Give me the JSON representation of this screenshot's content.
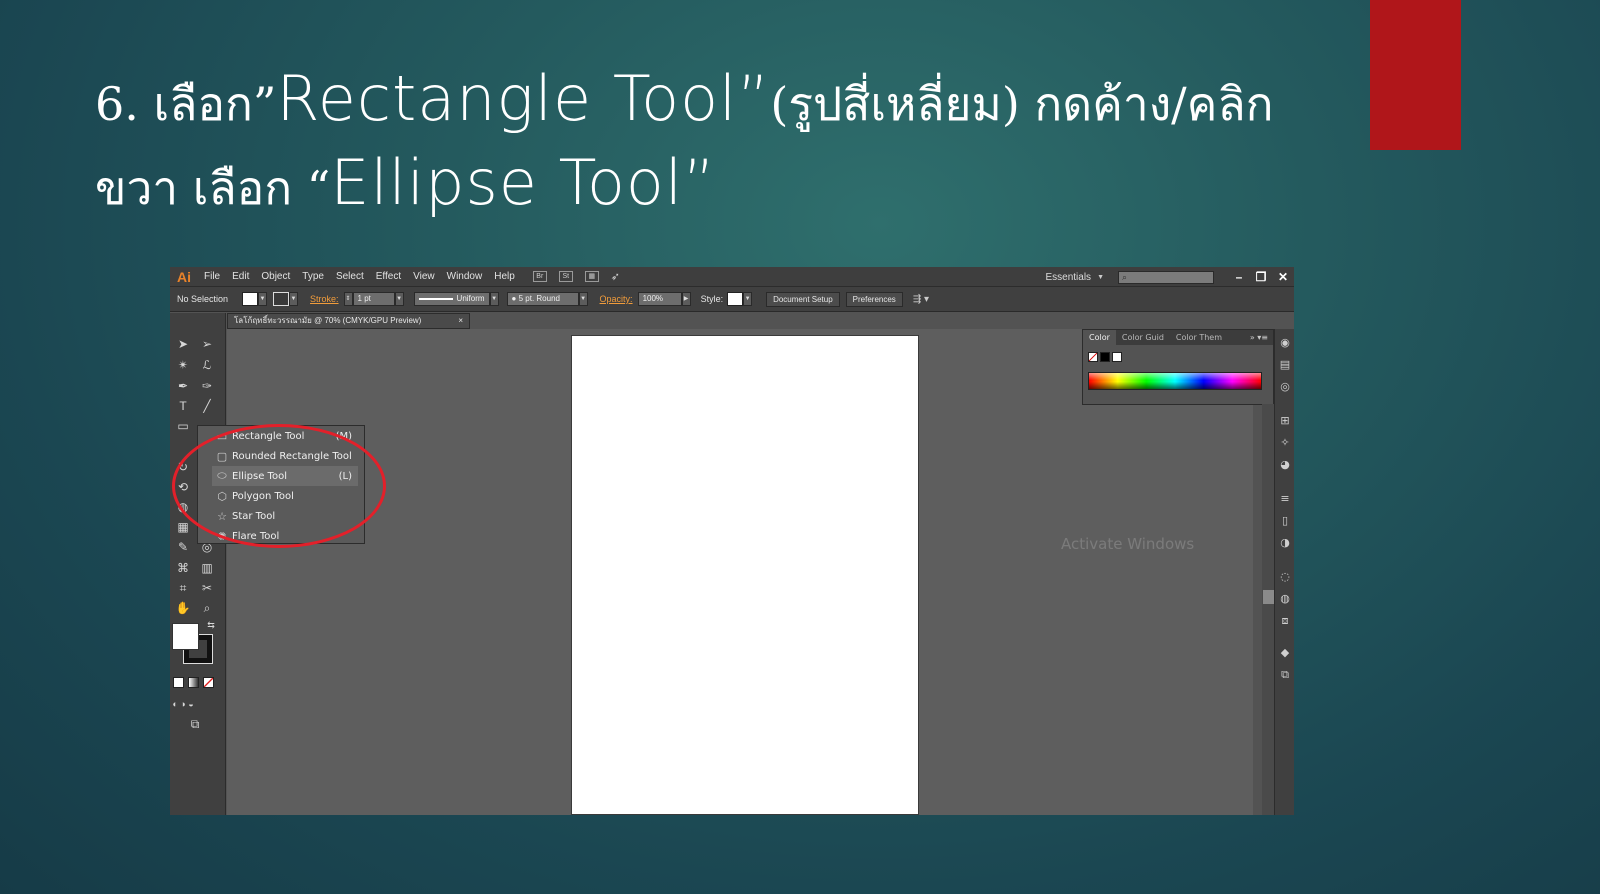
{
  "slide": {
    "title_line1": {
      "prefix": "6. เลือก”",
      "tool_name": "Rectangle Tool”",
      "suffix": " (รูปสี่เหลี่ยม) กดค้าง/คลิก"
    },
    "title_line2": {
      "prefix": "ขวา เลือก “",
      "tool_name": "Ellipse Tool”"
    }
  },
  "app": {
    "logo": "Ai",
    "menu": [
      "File",
      "Edit",
      "Object",
      "Type",
      "Select",
      "Effect",
      "View",
      "Window",
      "Help"
    ],
    "bridge_icon": "Br",
    "stock_icon": "St",
    "workspace": "Essentials",
    "window_controls": [
      "–",
      "❐",
      "✕"
    ]
  },
  "control_bar": {
    "selection": "No Selection",
    "stroke_label": "Stroke:",
    "stroke_value": "1 pt",
    "profile": "Uniform",
    "brush": "5 pt. Round",
    "opacity_label": "Opacity:",
    "opacity_value": "100%",
    "style_label": "Style:",
    "document_setup": "Document Setup",
    "preferences": "Preferences"
  },
  "document": {
    "tab_title": "โลโก้ฤทธิ์ทะวรรณามัย @ 70% (CMYK/GPU Preview)",
    "close": "×"
  },
  "flyout": {
    "items": [
      {
        "label": "Rectangle Tool",
        "shortcut": "(M)",
        "icon": "rectangle-icon"
      },
      {
        "label": "Rounded Rectangle Tool",
        "shortcut": "",
        "icon": "rounded-rectangle-icon"
      },
      {
        "label": "Ellipse Tool",
        "shortcut": "(L)",
        "icon": "ellipse-icon"
      },
      {
        "label": "Polygon Tool",
        "shortcut": "",
        "icon": "polygon-icon"
      },
      {
        "label": "Star Tool",
        "shortcut": "",
        "icon": "star-icon"
      },
      {
        "label": "Flare Tool",
        "shortcut": "",
        "icon": "flare-icon"
      }
    ],
    "highlighted": "Ellipse Tool"
  },
  "color_panel": {
    "tabs": [
      "Color",
      "Color Guid",
      "Color Them"
    ]
  },
  "watermark": "Activate Windows",
  "colors": {
    "accent_red": "#b0161a",
    "annotation_circle": "#e3202a",
    "ai_orange": "#e8822a"
  }
}
